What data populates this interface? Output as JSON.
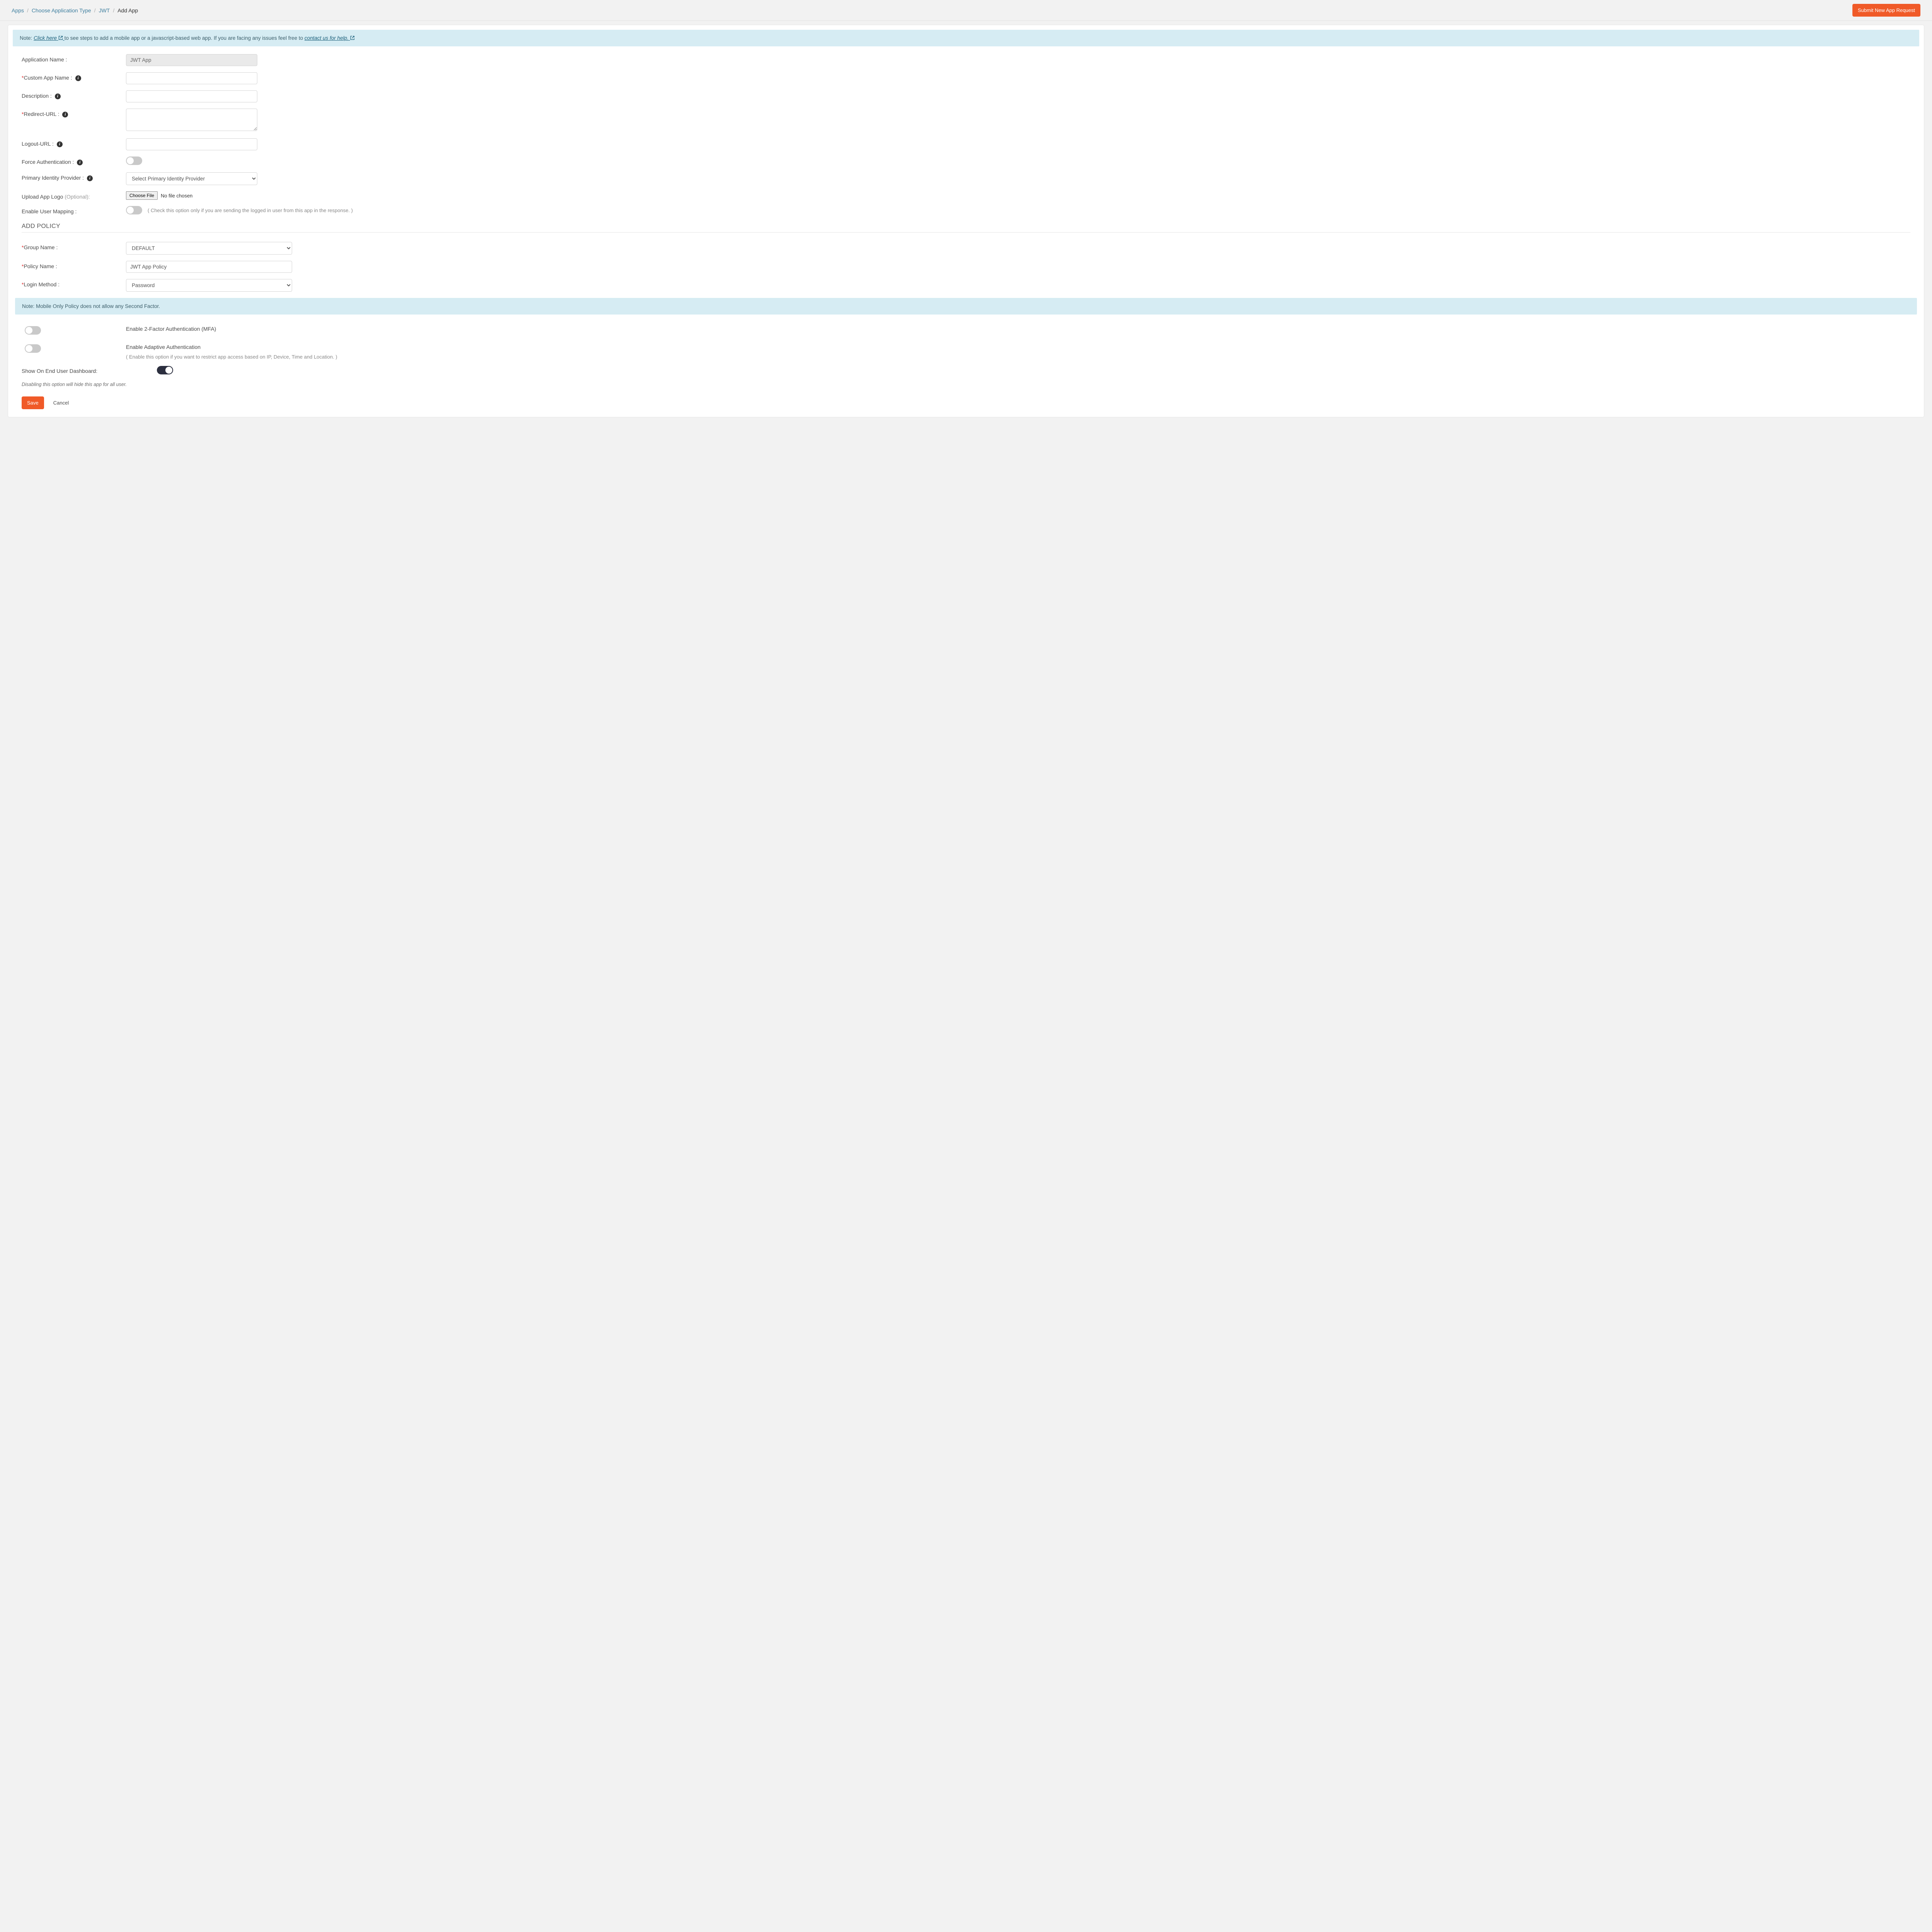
{
  "breadcrumb": {
    "items": [
      {
        "label": "Apps"
      },
      {
        "label": "Choose Application Type"
      },
      {
        "label": "JWT"
      }
    ],
    "current": "Add App",
    "separator": "/"
  },
  "header_button": "Submit New App Request",
  "note_bar": {
    "prefix": "Note: ",
    "link1": "Click here",
    "mid": " to see steps to add a mobile app or a javascript-based web app. If you are facing any issues feel free to ",
    "link2": "contact us for help."
  },
  "labels": {
    "app_name": "Application Name :",
    "custom_app_name": "Custom App Name :",
    "description": "Description :",
    "redirect_url": "Redirect-URL :",
    "logout_url": "Logout-URL :",
    "force_auth": "Force Authentication :",
    "pip": "Primary Identity Provider :",
    "upload_logo": "Upload App Logo ",
    "upload_logo_opt": "(Optional):",
    "enable_user_mapping": "Enable User Mapping :",
    "user_mapping_hint": "( Check this option only if you are sending the logged in user from this app in the response. )",
    "group_name": "Group Name :",
    "policy_name": "Policy Name :",
    "login_method": "Login Method :",
    "enable_mfa": "Enable 2-Factor Authentication (MFA)",
    "enable_adaptive": "Enable Adaptive Authentication",
    "adaptive_hint": "( Enable this option if you want to restrict app access based on IP, Device, Time and Location. )",
    "show_dashboard": "Show On End User Dashboard:",
    "dashboard_hint": "Disabling this option will hide this app for all user."
  },
  "values": {
    "app_name": "JWT App",
    "custom_app_name": "",
    "description": "",
    "redirect_url": "",
    "logout_url": "",
    "pip_placeholder": "Select Primary Identity Provider",
    "file_button": "Choose File",
    "file_status": "No file chosen",
    "group_name": "DEFAULT",
    "policy_name": "JWT App Policy",
    "login_method": "Password"
  },
  "section_add_policy": "ADD POLICY",
  "note_mobile_policy": "Note: Mobile Only Policy does not allow any Second Factor.",
  "actions": {
    "save": "Save",
    "cancel": "Cancel"
  }
}
